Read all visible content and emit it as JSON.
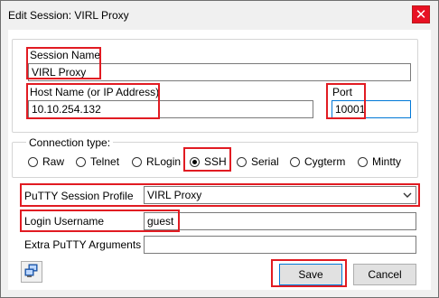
{
  "window": {
    "title": "Edit Session: VIRL Proxy",
    "close_glyph": "✕"
  },
  "session": {
    "name_label": "Session Name",
    "name_value": "VIRL Proxy"
  },
  "host": {
    "label": "Host Name (or IP Address)",
    "value": "10.10.254.132"
  },
  "port": {
    "label": "Port",
    "value": "10001"
  },
  "connection": {
    "group_label": "Connection type:",
    "options": [
      {
        "label": "Raw",
        "selected": false
      },
      {
        "label": "Telnet",
        "selected": false
      },
      {
        "label": "RLogin",
        "selected": false
      },
      {
        "label": "SSH",
        "selected": true
      },
      {
        "label": "Serial",
        "selected": false
      },
      {
        "label": "Cygterm",
        "selected": false
      },
      {
        "label": "Mintty",
        "selected": false
      }
    ]
  },
  "profile": {
    "label": "PuTTY Session Profile",
    "value": "VIRL Proxy"
  },
  "login": {
    "label": "Login Username",
    "value": "guest"
  },
  "extra": {
    "label": "Extra PuTTY Arguments",
    "value": ""
  },
  "buttons": {
    "save": "Save",
    "cancel": "Cancel"
  },
  "colors": {
    "highlight": "#e11b22",
    "close": "#e81123",
    "focus": "#0078d7"
  },
  "icons": {
    "close": "close-icon",
    "corner": "network-computers-icon",
    "dropdown": "chevron-down-icon"
  }
}
